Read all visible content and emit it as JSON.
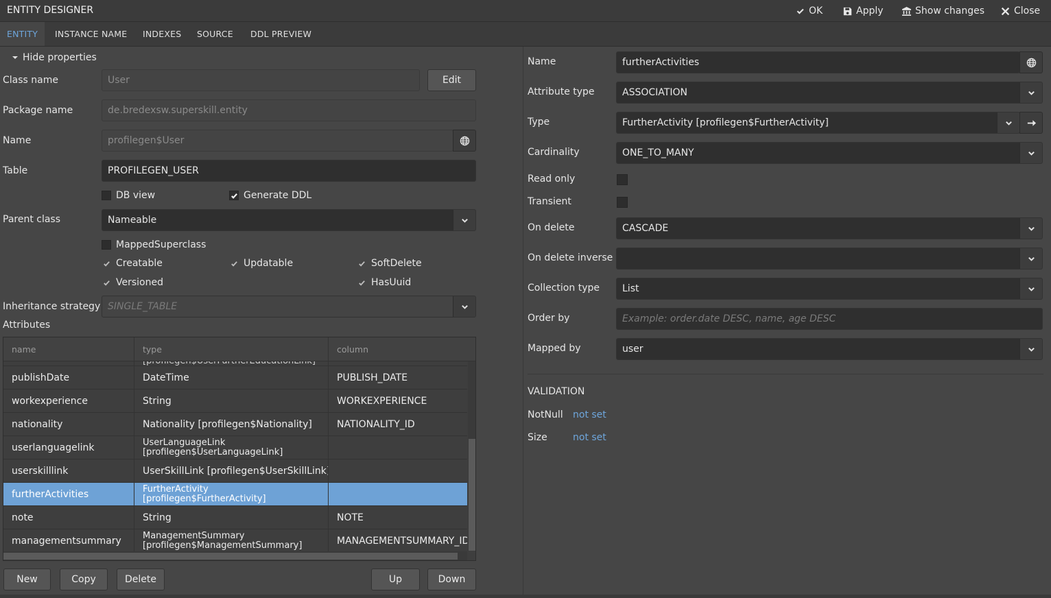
{
  "window": {
    "title": "ENTITY DESIGNER",
    "actions": {
      "ok": "OK",
      "apply": "Apply",
      "show_changes": "Show changes",
      "close": "Close"
    }
  },
  "tabs": [
    "ENTITY",
    "INSTANCE NAME",
    "INDEXES",
    "SOURCE",
    "DDL PREVIEW"
  ],
  "entity": {
    "hide_properties": "Hide properties",
    "class_name_label": "Class name",
    "class_name_value": "User",
    "edit_button": "Edit",
    "package_name_label": "Package name",
    "package_name_value": "de.bredexsw.superskill.entity",
    "name_label": "Name",
    "name_value": "profilegen$User",
    "table_label": "Table",
    "table_value": "PROFILEGEN_USER",
    "db_view": "DB view",
    "generate_ddl": "Generate DDL",
    "parent_class_label": "Parent class",
    "parent_class_value": "Nameable",
    "mapped_superclass": "MappedSuperclass",
    "creatable": "Creatable",
    "updatable": "Updatable",
    "soft_delete": "SoftDelete",
    "versioned": "Versioned",
    "has_uuid": "HasUuid",
    "inheritance_label": "Inheritance strategy",
    "inheritance_placeholder": "SINGLE_TABLE",
    "attributes_label": "Attributes"
  },
  "attributes_table": {
    "columns": [
      "name",
      "type",
      "column"
    ],
    "partial_row_type": "[profilegen$UserFurtherEducationLink]",
    "rows": [
      {
        "name": "publishDate",
        "type": "DateTime",
        "column": "PUBLISH_DATE"
      },
      {
        "name": "workexperience",
        "type": "String",
        "column": "WORKEXPERIENCE"
      },
      {
        "name": "nationality",
        "type": "Nationality [profilegen$Nationality]",
        "column": "NATIONALITY_ID"
      },
      {
        "name": "userlanguagelink",
        "type": "UserLanguageLink",
        "type2": "[profilegen$UserLanguageLink]",
        "column": ""
      },
      {
        "name": "userskilllink",
        "type": "UserSkillLink [profilegen$UserSkillLink]",
        "column": ""
      },
      {
        "name": "furtherActivities",
        "type": "FurtherActivity",
        "type2": "[profilegen$FurtherActivity]",
        "column": ""
      },
      {
        "name": "note",
        "type": "String",
        "column": "NOTE"
      },
      {
        "name": "managementsummary",
        "type": "ManagementSummary",
        "type2": "[profilegen$ManagementSummary]",
        "column": "MANAGEMENTSUMMARY_ID"
      }
    ]
  },
  "attr_buttons": {
    "new": "New",
    "copy": "Copy",
    "delete": "Delete",
    "up": "Up",
    "down": "Down"
  },
  "attribute": {
    "name_label": "Name",
    "name_value": "furtherActivities",
    "attr_type_label": "Attribute type",
    "attr_type_value": "ASSOCIATION",
    "type_label": "Type",
    "type_value": "FurtherActivity [profilegen$FurtherActivity]",
    "cardinality_label": "Cardinality",
    "cardinality_value": "ONE_TO_MANY",
    "read_only_label": "Read only",
    "transient_label": "Transient",
    "on_delete_label": "On delete",
    "on_delete_value": "CASCADE",
    "on_delete_inverse_label": "On delete inverse",
    "on_delete_inverse_value": "",
    "collection_type_label": "Collection type",
    "collection_type_value": "List",
    "order_by_label": "Order by",
    "order_by_placeholder": "Example: order.date DESC, name, age DESC",
    "mapped_by_label": "Mapped by",
    "mapped_by_value": "user"
  },
  "validation": {
    "title": "VALIDATION",
    "notnull_label": "NotNull",
    "notnull_value": "not set",
    "size_label": "Size",
    "size_value": "not set"
  },
  "colors": {
    "accent": "#6ea6dc",
    "selection": "#6ea2d6",
    "background": "#464646"
  }
}
